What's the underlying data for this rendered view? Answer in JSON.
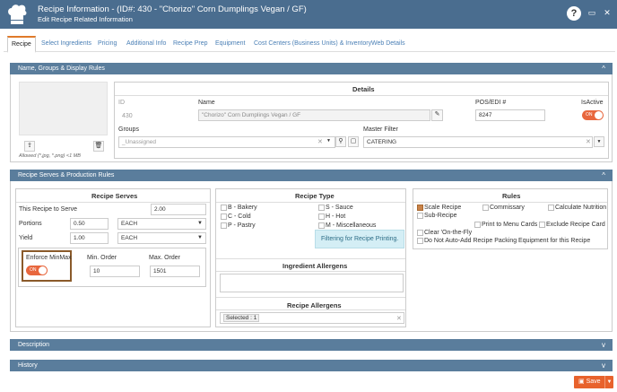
{
  "titlebar": {
    "title": "Recipe Information - (ID#: 430 - \"Chorizo\" Corn Dumplings Vegan / GF)",
    "subtitle": "Edit Recipe Related Information",
    "help": "?",
    "minimize": "▭",
    "close": "✕"
  },
  "tabs": [
    "Recipe",
    "Select Ingredients",
    "Pricing",
    "Additional Info",
    "Recipe Prep",
    "Equipment",
    "Cost Centers (Business Units) & Inventory",
    "Web Details"
  ],
  "name_panel": {
    "header": "Name, Groups & Display Rules",
    "upload_icon": "upload-icon",
    "delete_icon": "trash-icon",
    "allowed": "Allowed (*.jpg, *.png) <1 MB",
    "details_title": "Details",
    "id_label": "ID",
    "id_value": "430",
    "name_label": "Name",
    "name_value": "\"Chorizo\" Corn Dumplings Vegan / GF",
    "pos_label": "POS/EDI #",
    "pos_value": "8247",
    "isactive_label": "IsActive",
    "isactive_toggle": "ON",
    "groups_label": "Groups",
    "groups_value": "_Unassigned",
    "master_filter_label": "Master Filter",
    "master_filter_value": "CATERING"
  },
  "serves_panel": {
    "header": "Recipe Serves & Production Rules",
    "serves_title": "Recipe Serves",
    "this_recipe_label": "This Recipe to Serve",
    "this_recipe_value": "2.00",
    "portions_label": "Portions",
    "portions_value": "0.50",
    "portions_unit": "EACH",
    "yield_label": "Yield",
    "yield_value": "1.00",
    "yield_unit": "EACH",
    "enforce_label": "Enforce MinMax",
    "enforce_toggle": "ON",
    "min_label": "Min. Order",
    "min_value": "10",
    "max_label": "Max. Order",
    "max_value": "1501",
    "type_title": "Recipe Type",
    "types_left": [
      "B - Bakery",
      "C - Cold",
      "P - Pastry"
    ],
    "types_right": [
      "S - Sauce",
      "H - Hot",
      "M - Miscellaneous"
    ],
    "filter_note": "Filtering for Recipe Printing.",
    "ing_allergens_title": "Ingredient Allergens",
    "recipe_allergens_title": "Recipe Allergens",
    "recipe_allergens_value": "Selected : 1",
    "rules_title": "Rules",
    "rules": {
      "scale": "Scale Recipe",
      "commissary": "Commissary",
      "calc_nutrition": "Calculate Nutrition",
      "sub_recipe": "Sub-Recipe",
      "print_menu": "Print to Menu Cards",
      "exclude_card": "Exclude Recipe Card",
      "clear_otf": "Clear 'On-the-Fly",
      "no_auto_add": "Do Not Auto-Add Recipe Packing Equipment for this Recipe"
    }
  },
  "description_header": "Description",
  "history_header": "History",
  "save_label": "Save",
  "colors": {
    "titlebar": "#4a6d8f",
    "panel_header": "#5a7d9c",
    "accent": "#e8622c"
  }
}
